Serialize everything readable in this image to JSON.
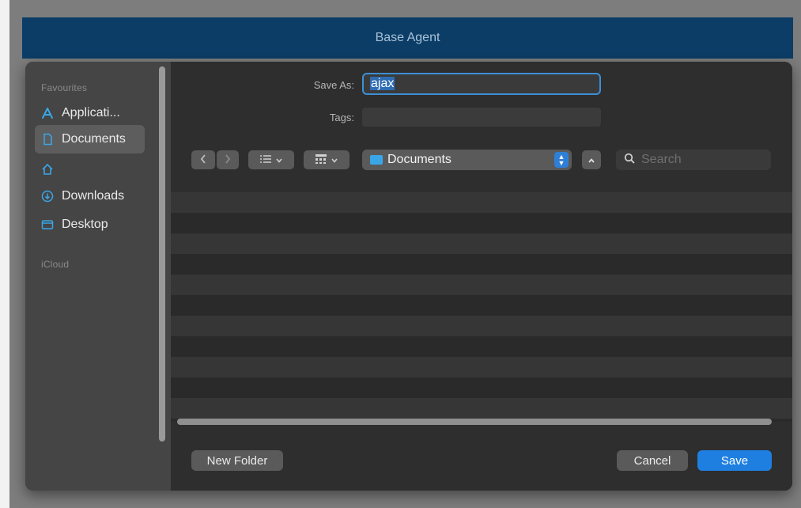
{
  "window": {
    "title": "Base Agent"
  },
  "sidebar": {
    "favourites_label": "Favourites",
    "items": [
      {
        "label": "Applicati...",
        "icon": "applications-icon"
      },
      {
        "label": "Documents",
        "icon": "document-icon",
        "selected": true
      },
      {
        "label": "",
        "icon": "home-icon"
      },
      {
        "label": "Downloads",
        "icon": "downloads-icon"
      },
      {
        "label": "Desktop",
        "icon": "desktop-icon"
      }
    ],
    "icloud_label": "iCloud"
  },
  "form": {
    "save_as_label": "Save As:",
    "save_as_value": "ajax",
    "tags_label": "Tags:",
    "tags_value": ""
  },
  "toolbar": {
    "location": "Documents",
    "search_placeholder": "Search"
  },
  "buttons": {
    "new_folder": "New Folder",
    "cancel": "Cancel",
    "save": "Save"
  },
  "colors": {
    "accent": "#1e7fe0",
    "titlebar": "#0b3d66",
    "folder": "#3aa6e6"
  }
}
